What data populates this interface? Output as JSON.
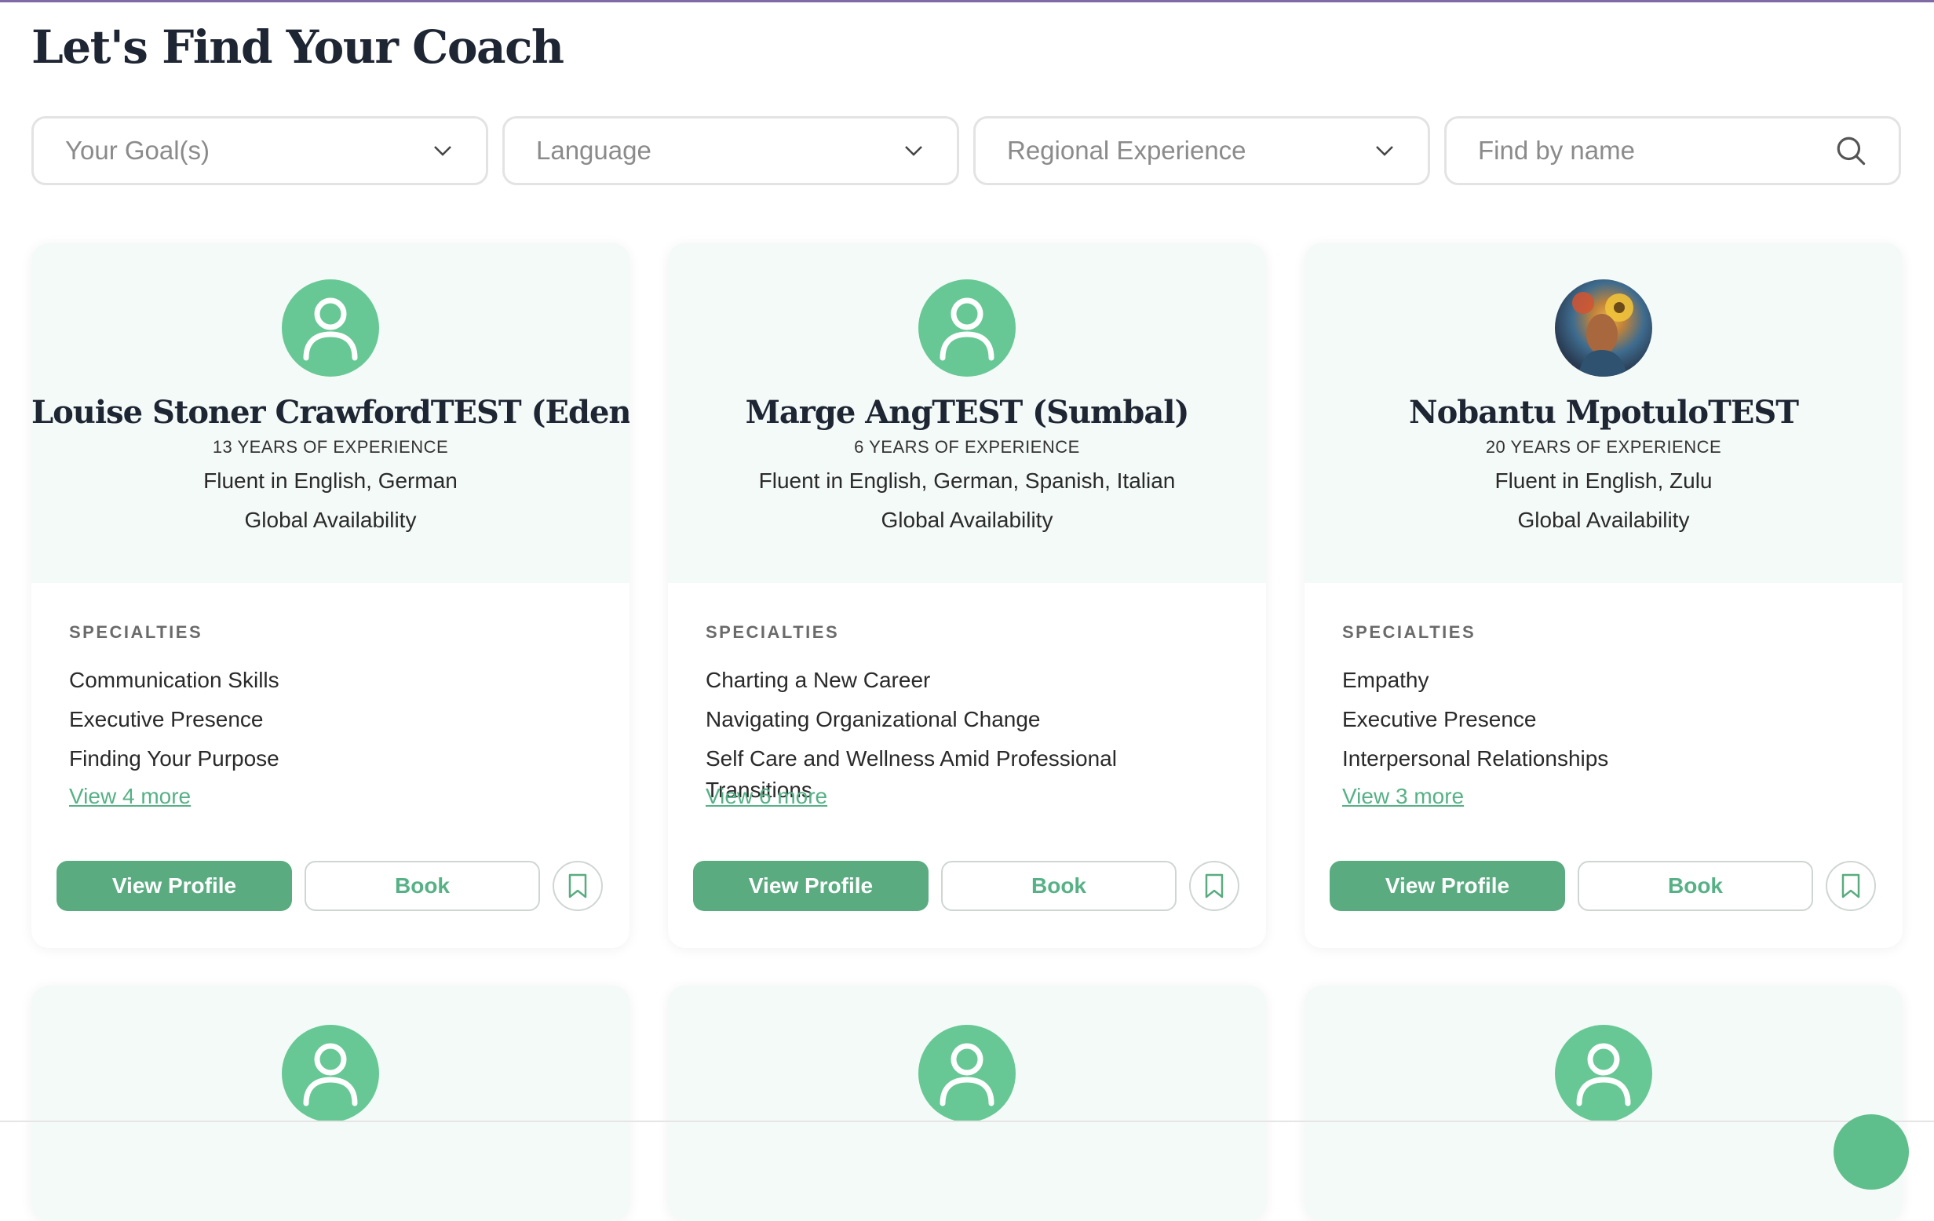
{
  "page": {
    "title": "Let's Find Your Coach"
  },
  "filters": {
    "goals": "Your Goal(s)",
    "language": "Language",
    "regional": "Regional Experience",
    "search_placeholder": "Find by name"
  },
  "cards": [
    {
      "name": "Louise Stoner CrawfordTEST (Eden)",
      "experience": "13 YEARS OF EXPERIENCE",
      "languages": "Fluent in English, German",
      "availability": "Global Availability",
      "specialties_heading": "SPECIALTIES",
      "specialties": [
        "Communication Skills",
        "Executive Presence",
        "Finding Your Purpose"
      ],
      "view_more": "View 4 more",
      "view_profile": "View Profile",
      "book": "Book"
    },
    {
      "name": "Marge AngTEST (Sumbal)",
      "experience": "6 YEARS OF EXPERIENCE",
      "languages": "Fluent in English, German, Spanish, Italian",
      "availability": "Global Availability",
      "specialties_heading": "SPECIALTIES",
      "specialties": [
        "Charting a New Career",
        "Navigating Organizational Change",
        "Self Care and Wellness Amid Professional Transitions"
      ],
      "view_more": "View 6 more",
      "view_profile": "View Profile",
      "book": "Book"
    },
    {
      "name": "Nobantu MpotuloTEST",
      "experience": "20 YEARS OF EXPERIENCE",
      "languages": "Fluent in English, Zulu",
      "availability": "Global Availability",
      "specialties_heading": "SPECIALTIES",
      "specialties": [
        "Empathy",
        "Executive Presence",
        "Interpersonal Relationships"
      ],
      "view_more": "View 3 more",
      "view_profile": "View Profile",
      "book": "Book"
    }
  ],
  "colors": {
    "accent": "#5aac80",
    "avatar_bg": "#67c895",
    "card_header_bg": "#f4faf7",
    "link": "#57b186",
    "title": "#1e2533"
  },
  "icons": [
    "chevron-down-icon",
    "search-icon",
    "user-icon",
    "bookmark-icon",
    "chat-icon"
  ]
}
